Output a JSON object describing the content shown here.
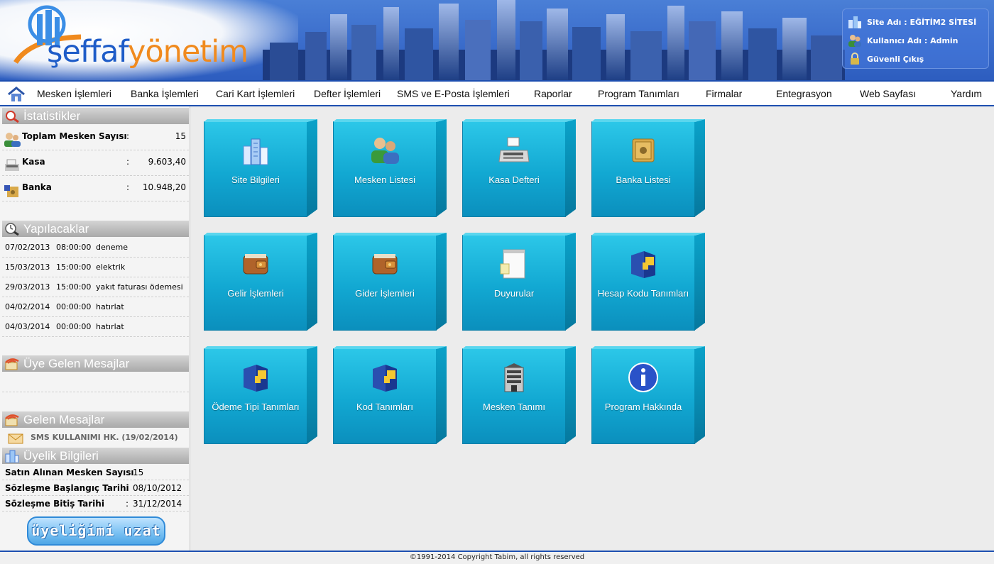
{
  "header": {
    "logo_part1": "şeffaf",
    "logo_part2": "yönetim",
    "site_name": "Site Adı : EĞİTİM2 SİTESİ",
    "user_name": "Kullanıcı Adı : Admin",
    "logout": "Güvenli Çıkış"
  },
  "menu": [
    "Mesken İşlemleri",
    "Banka İşlemleri",
    "Cari Kart İşlemleri",
    "Defter İşlemleri",
    "SMS ve E-Posta İşlemleri",
    "Raporlar",
    "Program Tanımları",
    "Firmalar",
    "Entegrasyon",
    "Web Sayfası",
    "Yardım"
  ],
  "sidebar": {
    "stats_title": "İstatistikler",
    "stats": [
      {
        "label": "Toplam Mesken Sayısı",
        "colon": ":",
        "value": "15"
      },
      {
        "label": "Kasa",
        "colon": ":",
        "value": "9.603,40"
      },
      {
        "label": "Banka",
        "colon": ":",
        "value": "10.948,20"
      }
    ],
    "todo_title": "Yapılacaklar",
    "todos": [
      {
        "date": "07/02/2013",
        "time": "08:00:00",
        "text": "deneme"
      },
      {
        "date": "15/03/2013",
        "time": "15:00:00",
        "text": "elektrik"
      },
      {
        "date": "29/03/2013",
        "time": "15:00:00",
        "text": "yakıt faturası ödemesi"
      },
      {
        "date": "04/02/2014",
        "time": "00:00:00",
        "text": "hatırlat"
      },
      {
        "date": "04/03/2014",
        "time": "00:00:00",
        "text": "hatırlat"
      }
    ],
    "member_msgs_title": "Üye Gelen Mesajlar",
    "incoming_title": "Gelen Mesajlar",
    "incoming": [
      {
        "text": "SMS KULLANIMI HK.  (19/02/2014)"
      }
    ],
    "membership_title": "Üyelik Bilgileri",
    "membership": [
      {
        "label": "Satın Alınan Mesken Sayısı",
        "colon": ":",
        "value": "15"
      },
      {
        "label": "Sözleşme Başlangıç Tarihi",
        "colon": ":",
        "value": "08/10/2012"
      },
      {
        "label": "Sözleşme Bitiş Tarihi",
        "colon": ":",
        "value": "31/12/2014"
      }
    ],
    "extend_button": "üyeliğimi uzat"
  },
  "tiles": [
    {
      "label": "Site Bilgileri",
      "icon": "buildings-icon"
    },
    {
      "label": "Mesken Listesi",
      "icon": "users-icon"
    },
    {
      "label": "Kasa Defteri",
      "icon": "cash-register-icon"
    },
    {
      "label": "Banka Listesi",
      "icon": "safe-icon"
    },
    {
      "label": "Gelir İşlemleri",
      "icon": "wallet-icon"
    },
    {
      "label": "Gider İşlemleri",
      "icon": "wallet-icon"
    },
    {
      "label": "Duyurular",
      "icon": "notepad-icon"
    },
    {
      "label": "Hesap Kodu Tanımları",
      "icon": "cube-icon"
    },
    {
      "label": "Ödeme Tipi Tanımları",
      "icon": "cube-icon"
    },
    {
      "label": "Kod Tanımları",
      "icon": "cube-icon"
    },
    {
      "label": "Mesken Tanımı",
      "icon": "building-icon"
    },
    {
      "label": "Program Hakkında",
      "icon": "info-icon"
    }
  ],
  "footer": "©1991-2014 Copyright Tabim, all rights reserved",
  "colors": {
    "header_blue": "#3a6ccb",
    "logo_blue": "#1e5cc8",
    "logo_orange": "#f08a1e",
    "tile_cyan": "#12a8d2",
    "menu_border": "#1d4fb0"
  }
}
